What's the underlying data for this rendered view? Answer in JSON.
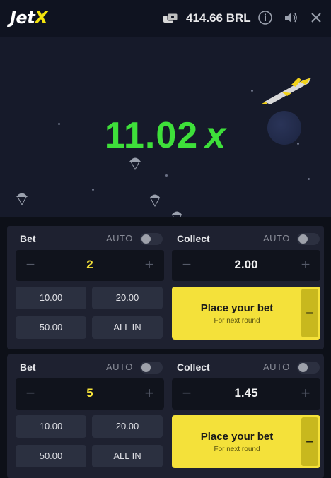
{
  "header": {
    "logo_prefix": "Jet",
    "logo_x": "X",
    "balance": "414.66 BRL",
    "icons": [
      "wallet-icon",
      "info-icon",
      "sound-icon",
      "close-icon"
    ]
  },
  "game": {
    "multiplier_value": "11.02",
    "multiplier_suffix": "x",
    "multiplier_color": "#3ee03a"
  },
  "bet_panels": [
    {
      "bet_label": "Bet",
      "auto_label": "AUTO",
      "collect_label": "Collect",
      "bet_value": "2",
      "collect_value": "2.00",
      "chips": [
        "10.00",
        "20.00",
        "50.00",
        "ALL IN"
      ],
      "place_label": "Place your bet",
      "place_sub": "For next round",
      "side_label": "–"
    },
    {
      "bet_label": "Bet",
      "auto_label": "AUTO",
      "collect_label": "Collect",
      "bet_value": "5",
      "collect_value": "1.45",
      "chips": [
        "10.00",
        "20.00",
        "50.00",
        "ALL IN"
      ],
      "place_label": "Place your bet",
      "place_sub": "For next round",
      "side_label": "–"
    }
  ],
  "colors": {
    "accent_yellow": "#f4e13a",
    "background": "#0d1018",
    "panel": "#1e2130"
  }
}
